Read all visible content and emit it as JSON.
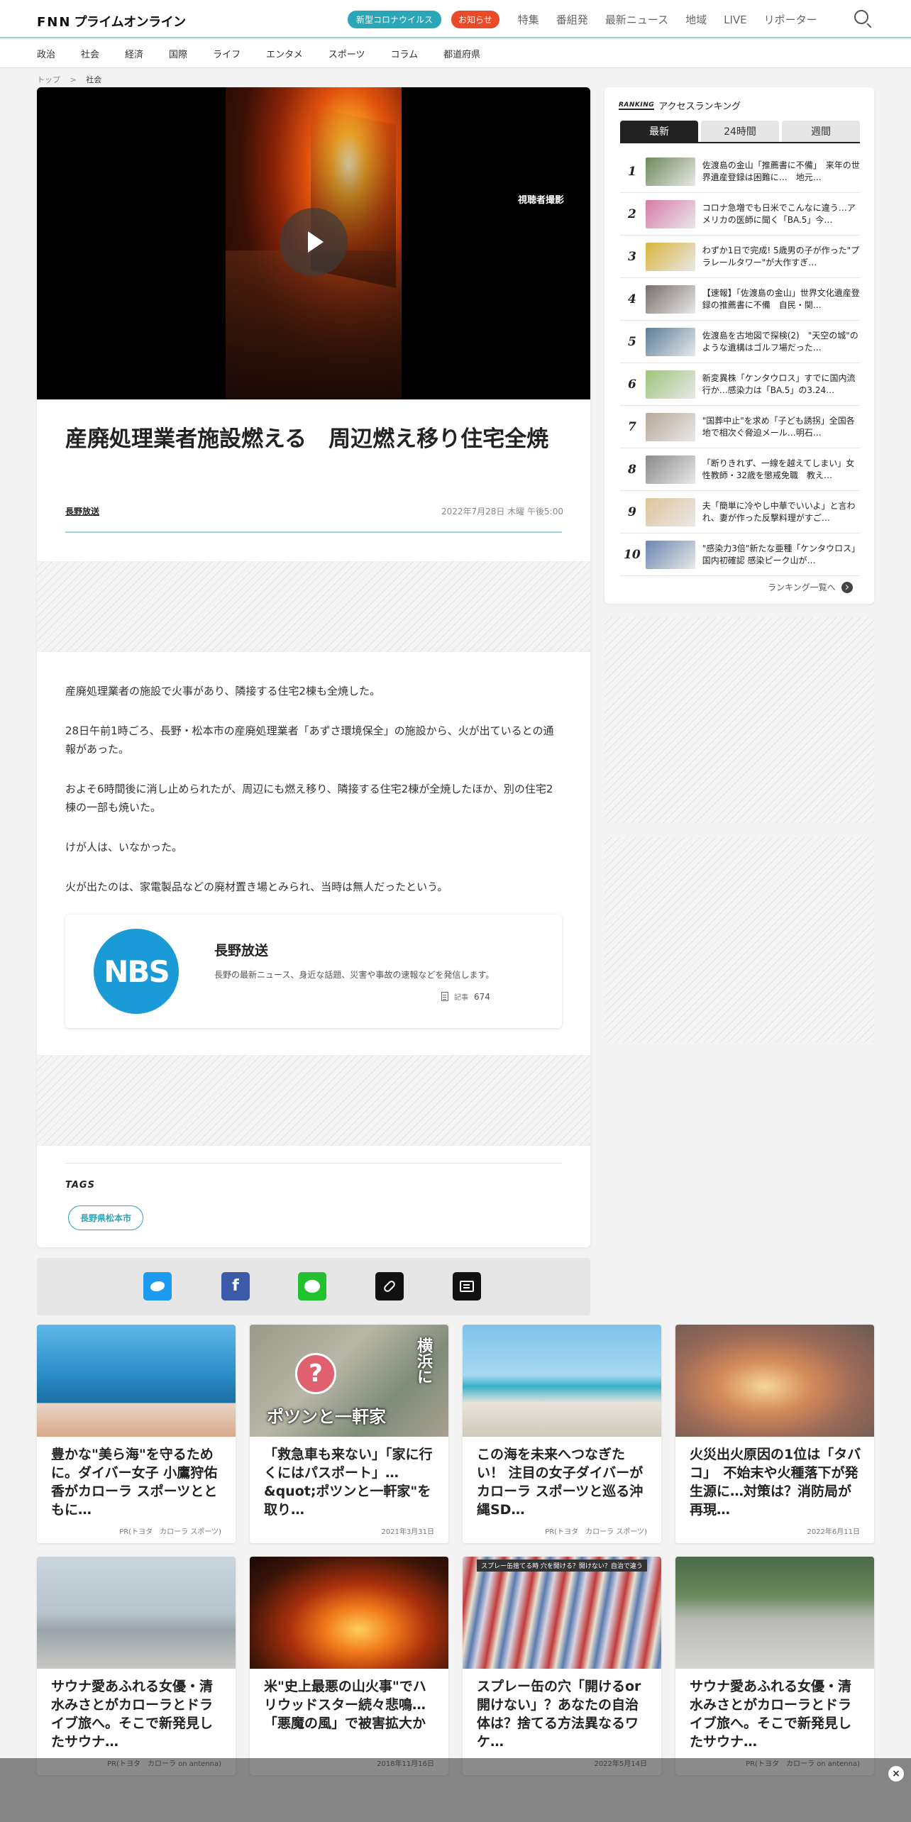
{
  "header": {
    "logo_fnn": "FNN",
    "logo_text": "プライムオンライン",
    "pill_covid": "新型コロナウイルス",
    "pill_notice": "お知らせ",
    "links": [
      "特集",
      "番組発",
      "最新ニュース",
      "地域",
      "LIVE",
      "リポーター"
    ]
  },
  "subnav": [
    "政治",
    "社会",
    "経済",
    "国際",
    "ライフ",
    "エンタメ",
    "スポーツ",
    "コラム",
    "都道府県"
  ],
  "breadcrumb": {
    "top": "トップ",
    "sep": ">",
    "current": "社会"
  },
  "article": {
    "video_caption": "視聴者撮影",
    "title": "産廃処理業者施設燃える　周辺燃え移り住宅全焼",
    "source": "長野放送",
    "date": "2022年7月28日 木曜 午後5:00",
    "paragraphs": [
      "産廃処理業者の施設で火事があり、隣接する住宅2棟も全焼した。",
      "28日午前1時ごろ、長野・松本市の産廃処理業者「あずさ環境保全」の施設から、火が出ているとの通報があった。",
      "およそ6時間後に消し止められたが、周辺にも燃え移り、隣接する住宅2棟が全焼したほか、別の住宅2棟の一部も焼いた。",
      "けが人は、いなかった。",
      "火が出たのは、家電製品などの廃材置き場とみられ、当時は無人だったという。"
    ],
    "publisher": {
      "logo_text": "NBS",
      "name": "長野放送",
      "description": "長野の最新ニュース、身近な話題、災害や事故の速報などを発信します。",
      "count_label": "記事",
      "count": "674"
    },
    "tags_title": "TAGS",
    "tags": [
      "長野県松本市"
    ]
  },
  "ranking": {
    "en": "RANKING",
    "title": "アクセスランキング",
    "tabs": [
      "最新",
      "24時間",
      "週間"
    ],
    "items": [
      {
        "num": "1",
        "text": "佐渡島の金山「推薦書に不備」　来年の世界遺産登録は困難に…　地元…",
        "color": "#6d8a5a"
      },
      {
        "num": "2",
        "text": "コロナ急増でも日米でこんなに違う…アメリカの医師に聞く「BA.5」今…",
        "color": "#d87aa8"
      },
      {
        "num": "3",
        "text": "わずか1日で完成! 5歳男の子が作った\"プラレールタワー\"が大作すぎ…",
        "color": "#d9b43a"
      },
      {
        "num": "4",
        "text": "【速報】「佐渡島の金山」世界文化遺産登録の推薦書に不備　自民・関…",
        "color": "#7a6e6a"
      },
      {
        "num": "5",
        "text": "佐渡島を古地図で探検(2)　\"天空の城\"のような遺構はゴルフ場だった…",
        "color": "#5c7e9a"
      },
      {
        "num": "6",
        "text": "新変異株「ケンタウロス」すでに国内流行か…感染力は「BA.5」の3.24…",
        "color": "#9ec47a"
      },
      {
        "num": "7",
        "text": "\"国葬中止\"を求め「子ども誘拐」全国各地で相次ぐ脅迫メール…明石…",
        "color": "#b8a89a"
      },
      {
        "num": "8",
        "text": "「断りきれず、一線を越えてしまい」女性教師・32歳を懲戒免職　教え…",
        "color": "#8a8a8a"
      },
      {
        "num": "9",
        "text": "夫「簡単に冷やし中華でいいよ」と言われ、妻が作った反撃料理がすご…",
        "color": "#e0c49a"
      },
      {
        "num": "10",
        "text": "\"感染力3倍\"新たな亜種「ケンタウロス」国内初確認 感染ピーク山が…",
        "color": "#6a86b0"
      }
    ],
    "more": "ランキング一覧へ"
  },
  "cards": [
    {
      "title": "豊かな\"美ら海\"を守るために。ダイバー女子 小鷹狩佑香がカローラ スポーツとともに…",
      "meta": "PR(トヨタ　カローラ スポーツ)"
    },
    {
      "title": "「救急車も来ない」「家に行くにはパスポート」…&quot;ポツンと一軒家\"を取り…",
      "meta": "2021年3月31日",
      "badge": "?",
      "cap": "ポツンと一軒家",
      "cap_v": "横浜に"
    },
    {
      "title": "この海を未来へつなぎたい！ 注目の女子ダイバーがカローラ スポーツと巡る沖縄SD…",
      "meta": "PR(トヨタ　カローラ スポーツ)"
    },
    {
      "title": "火災出火原因の1位は「タバコ」　不始末や火種落下が発生源に…対策は？消防局が再現…",
      "meta": "2022年6月11日"
    },
    {
      "title": "サウナ愛あふれる女優・清水みさとがカローラとドライブ旅へ。そこで新発見したサウナ…",
      "meta": "PR(トヨタ　カローラ on antenna)"
    },
    {
      "title": "米\"史上最悪の山火事\"でハリウッドスター続々悲鳴…「悪魔の風」で被害拡大か",
      "meta": "2018年11月16日"
    },
    {
      "title": "スプレー缶の穴「開けるor 開けない」？あなたの自治体は？捨てる方法異なるワケ…",
      "meta": "2022年5月14日",
      "banner": "スプレー缶捨てる時 穴を開ける？開けない？自治で違う"
    },
    {
      "title": "サウナ愛あふれる女優・清水みさとがカローラとドライブ旅へ。そこで新発見したサウナ…",
      "meta": "PR(トヨタ　カローラ on antenna)"
    }
  ],
  "close_label": "×"
}
